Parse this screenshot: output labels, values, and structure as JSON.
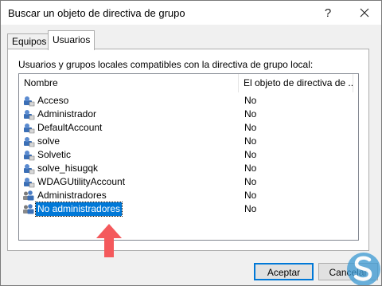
{
  "window": {
    "title": "Buscar un objeto de directiva de grupo",
    "help_label": "?"
  },
  "tabs": [
    {
      "label": "Equipos",
      "selected": false
    },
    {
      "label": "Usuarios",
      "selected": true
    }
  ],
  "panel": {
    "label": "Usuarios y grupos locales compatibles con la directiva de grupo local:",
    "columns": [
      "Nombre",
      "El objeto de directiva de ..."
    ],
    "rows": [
      {
        "name": "Acceso",
        "value": "No",
        "icon": "user-icon"
      },
      {
        "name": "Administrador",
        "value": "No",
        "icon": "user-icon"
      },
      {
        "name": "DefaultAccount",
        "value": "No",
        "icon": "user-icon"
      },
      {
        "name": "solve",
        "value": "No",
        "icon": "user-icon"
      },
      {
        "name": "Solvetic",
        "value": "No",
        "icon": "user-icon"
      },
      {
        "name": "solve_hisugqk",
        "value": "No",
        "icon": "user-icon"
      },
      {
        "name": "WDAGUtilityAccount",
        "value": "No",
        "icon": "user-icon"
      },
      {
        "name": "Administradores",
        "value": "No",
        "icon": "group-icon"
      },
      {
        "name": "No administradores",
        "value": "No",
        "icon": "group-icon",
        "selected": true
      }
    ]
  },
  "buttons": {
    "ok": "Aceptar",
    "cancel": "Cancelar"
  },
  "colors": {
    "selection": "#0078d7",
    "annotation_arrow": "#f4595c"
  }
}
